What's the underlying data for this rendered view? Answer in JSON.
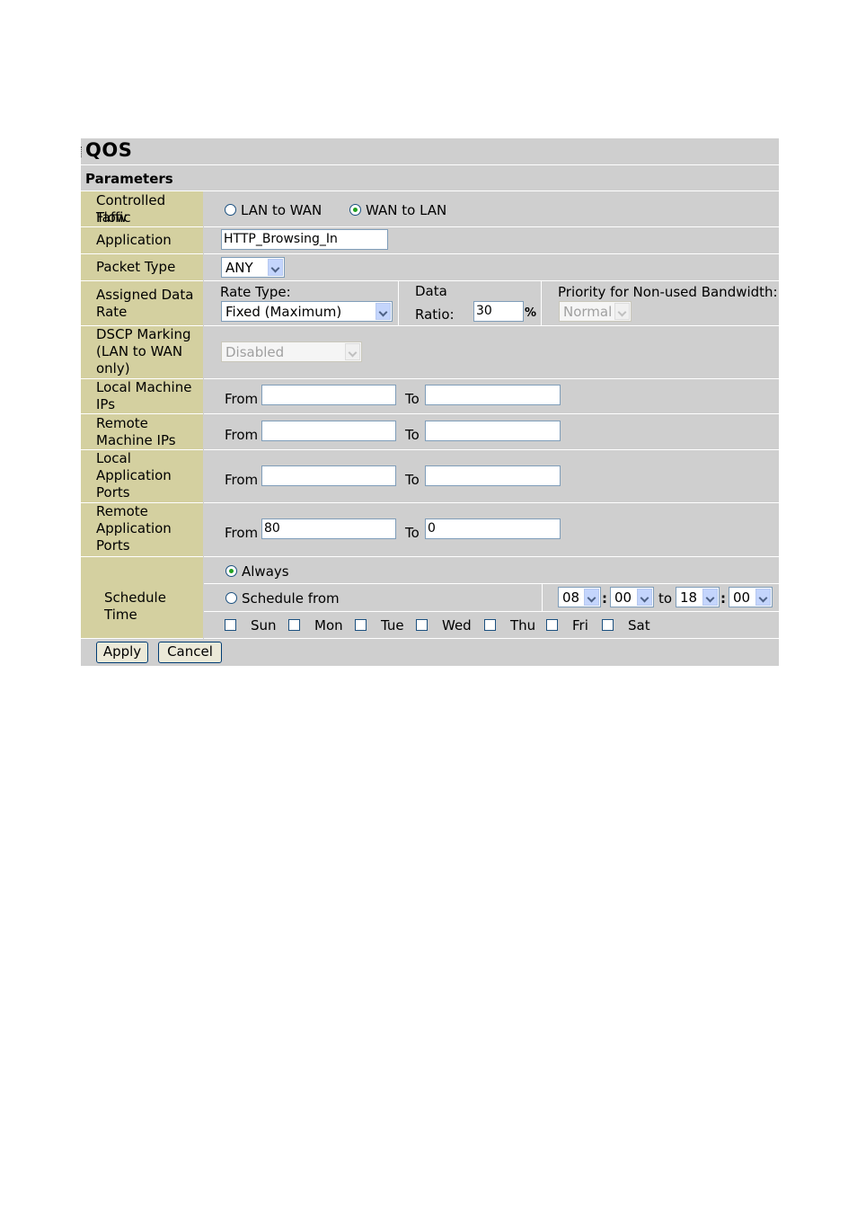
{
  "page": {
    "title": "QOS",
    "section": "Parameters"
  },
  "labels": {
    "flow": [
      "Controlled Taffic",
      "Flow"
    ],
    "application": "Application",
    "packet_type": "Packet Type",
    "assigned_rate": [
      "Assigned Data",
      "Rate"
    ],
    "dscp": [
      "DSCP Marking",
      "(LAN to WAN",
      "only)"
    ],
    "local_ips": [
      "Local Machine",
      "IPs"
    ],
    "remote_ips": [
      "Remote",
      "Machine IPs"
    ],
    "local_ports": [
      "Local",
      "Application",
      "Ports"
    ],
    "remote_ports": [
      "Remote",
      "Application",
      "Ports"
    ],
    "schedule": "Schedule Time"
  },
  "flow": {
    "options": [
      "LAN to WAN",
      "WAN to LAN"
    ],
    "selected": "WAN to LAN"
  },
  "application": {
    "value": "HTTP_Browsing_In"
  },
  "packet_type": {
    "value": "ANY"
  },
  "rate": {
    "rate_type_label": "Rate Type:",
    "rate_type_value": "Fixed (Maximum)",
    "data_label": "Data",
    "ratio_label": "Ratio:",
    "ratio_value": "30",
    "percent": "%",
    "priority_label": "Priority for Non-used Bandwidth:",
    "priority_value": "Normal"
  },
  "dscp": {
    "value": "Disabled"
  },
  "range": {
    "from_label": "From",
    "to_label": "To"
  },
  "local_ips": {
    "from": "",
    "to": ""
  },
  "remote_ips": {
    "from": "",
    "to": ""
  },
  "local_ports": {
    "from": "",
    "to": ""
  },
  "remote_ports": {
    "from": "80",
    "to": "0"
  },
  "schedule": {
    "always_label": "Always",
    "schedule_from_label": "Schedule from",
    "selected": "Always",
    "start_hour": "08",
    "start_min": "00",
    "to_label": "to",
    "end_hour": "18",
    "end_min": "00",
    "colon": ":",
    "days": [
      "Sun",
      "Mon",
      "Tue",
      "Wed",
      "Thu",
      "Fri",
      "Sat"
    ]
  },
  "buttons": {
    "apply": "Apply",
    "cancel": "Cancel"
  }
}
